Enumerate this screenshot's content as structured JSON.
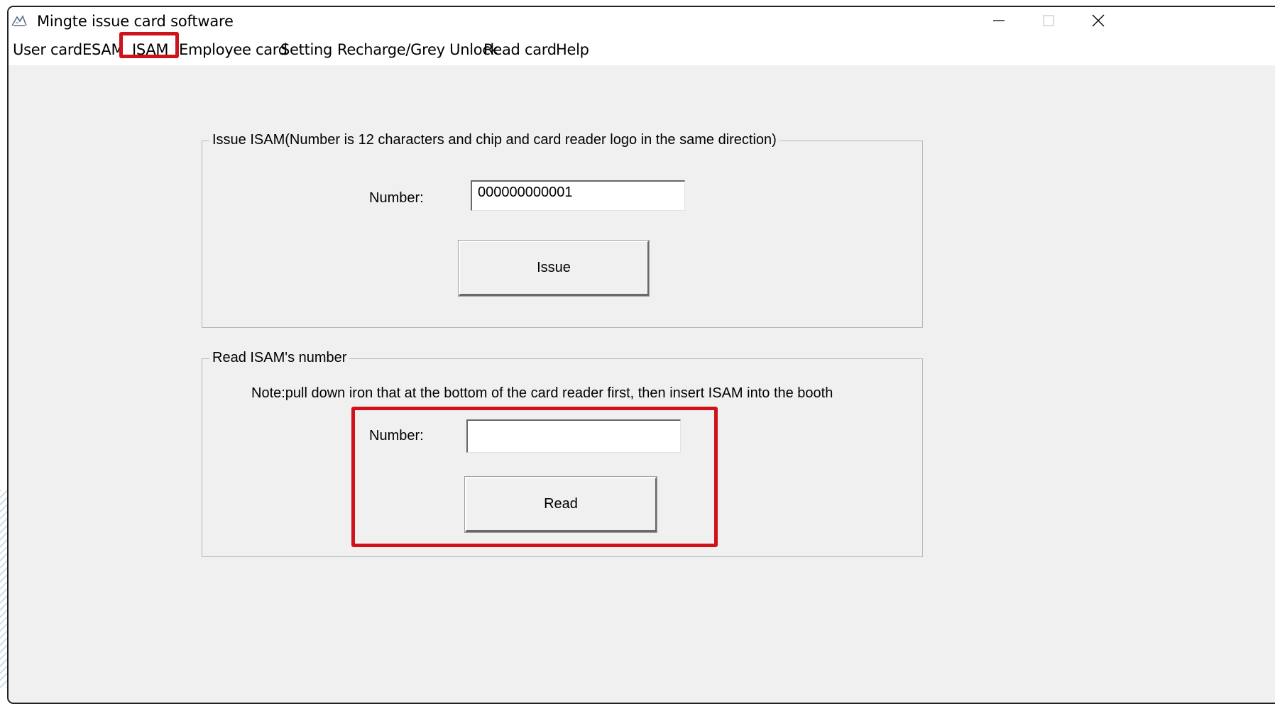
{
  "window": {
    "title": "Mingte issue card software",
    "icons": {
      "app": "app-logo-icon",
      "minimize": "minimize-icon",
      "maximize": "maximize-icon",
      "close": "close-icon"
    }
  },
  "menu": {
    "items": [
      "User card",
      "ESAM",
      "ISAM",
      "Employee card",
      "Setting",
      "Recharge/Grey Unlock",
      "Read card",
      "Help"
    ],
    "active": "ISAM"
  },
  "issue_group": {
    "title": "Issue ISAM(Number is 12 characters and chip and card reader logo in the same direction)",
    "number_label": "Number:",
    "number_value": "000000000001",
    "issue_button": "Issue"
  },
  "read_group": {
    "title": "Read ISAM's number",
    "note": "Note:pull down iron that at the bottom of the card reader first, then insert ISAM into the booth",
    "number_label": "Number:",
    "number_value": "",
    "read_button": "Read"
  },
  "colors": {
    "highlight": "#d0121b",
    "window_bg": "#f0f0f0"
  }
}
